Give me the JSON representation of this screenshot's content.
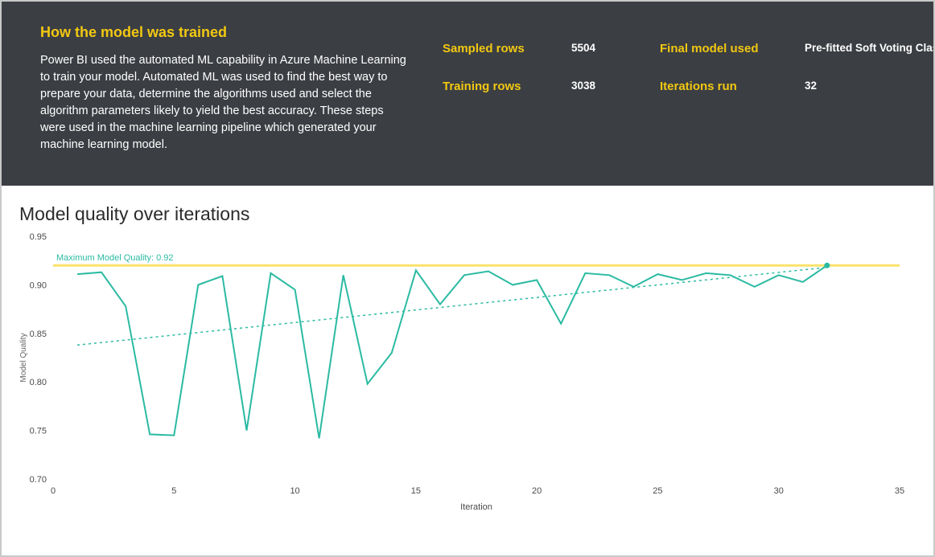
{
  "hero": {
    "title": "How the model was trained",
    "description": "Power BI used the automated ML capability in Azure Machine Learning to train your model. Automated ML was used to find the best way to prepare your data, determine the algorithms used and select the algorithm parameters likely to yield the best accuracy. These steps were used in the machine learning pipeline which generated your machine learning model.",
    "stats": {
      "sampled_rows_label": "Sampled rows",
      "sampled_rows_value": "5504",
      "training_rows_label": "Training rows",
      "training_rows_value": "3038",
      "final_model_label": "Final model used",
      "final_model_value": "Pre-fitted Soft Voting Classifier",
      "iterations_label": "Iterations run",
      "iterations_value": "32"
    }
  },
  "chart_data": {
    "type": "line",
    "title": "Model quality over iterations",
    "xlabel": "Iteration",
    "ylabel": "Model Quality",
    "xlim": [
      0,
      35
    ],
    "ylim": [
      0.7,
      0.95
    ],
    "xticks": [
      0,
      5,
      10,
      15,
      20,
      25,
      30,
      35
    ],
    "yticks": [
      0.7,
      0.75,
      0.8,
      0.85,
      0.9,
      0.95
    ],
    "reference_line": {
      "value": 0.92,
      "label": "Maximum Model Quality: 0.92"
    },
    "series": [
      {
        "name": "Model Quality",
        "x": [
          1,
          2,
          3,
          4,
          5,
          6,
          7,
          8,
          9,
          10,
          11,
          12,
          13,
          14,
          15,
          16,
          17,
          18,
          19,
          20,
          21,
          22,
          23,
          24,
          25,
          26,
          27,
          28,
          29,
          30,
          31,
          32
        ],
        "y": [
          0.911,
          0.913,
          0.878,
          0.746,
          0.745,
          0.9,
          0.909,
          0.75,
          0.912,
          0.895,
          0.742,
          0.91,
          0.798,
          0.83,
          0.915,
          0.88,
          0.91,
          0.914,
          0.9,
          0.905,
          0.86,
          0.912,
          0.91,
          0.898,
          0.911,
          0.905,
          0.912,
          0.91,
          0.898,
          0.91,
          0.903,
          0.92
        ]
      }
    ],
    "trend": {
      "x1": 1,
      "y1": 0.838,
      "x2": 32,
      "y2": 0.918
    }
  }
}
